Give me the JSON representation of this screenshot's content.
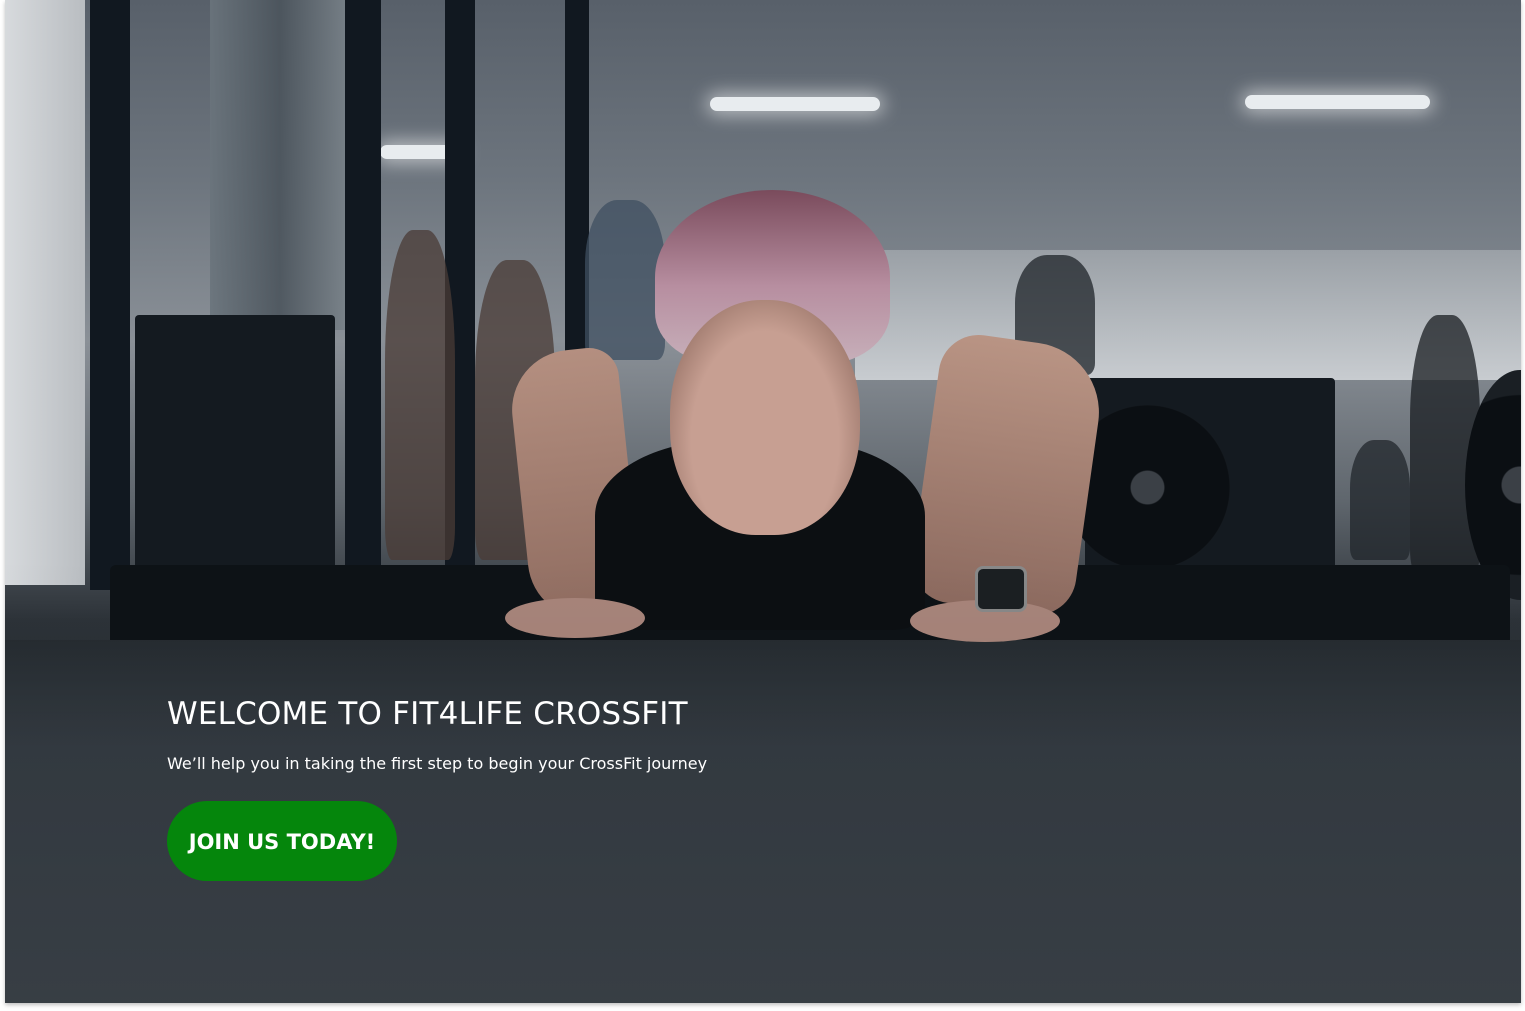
{
  "hero": {
    "title": "WELCOME TO FIT4LIFE CROSSFIT",
    "subtitle": "We’ll help you in taking the first step to begin your CrossFit journey",
    "cta_label": "JOIN US TODAY!",
    "cta_color": "#05860c",
    "text_color": "#ffffff"
  },
  "background": {
    "image": "crossfit-athlete-pushup-photo"
  }
}
